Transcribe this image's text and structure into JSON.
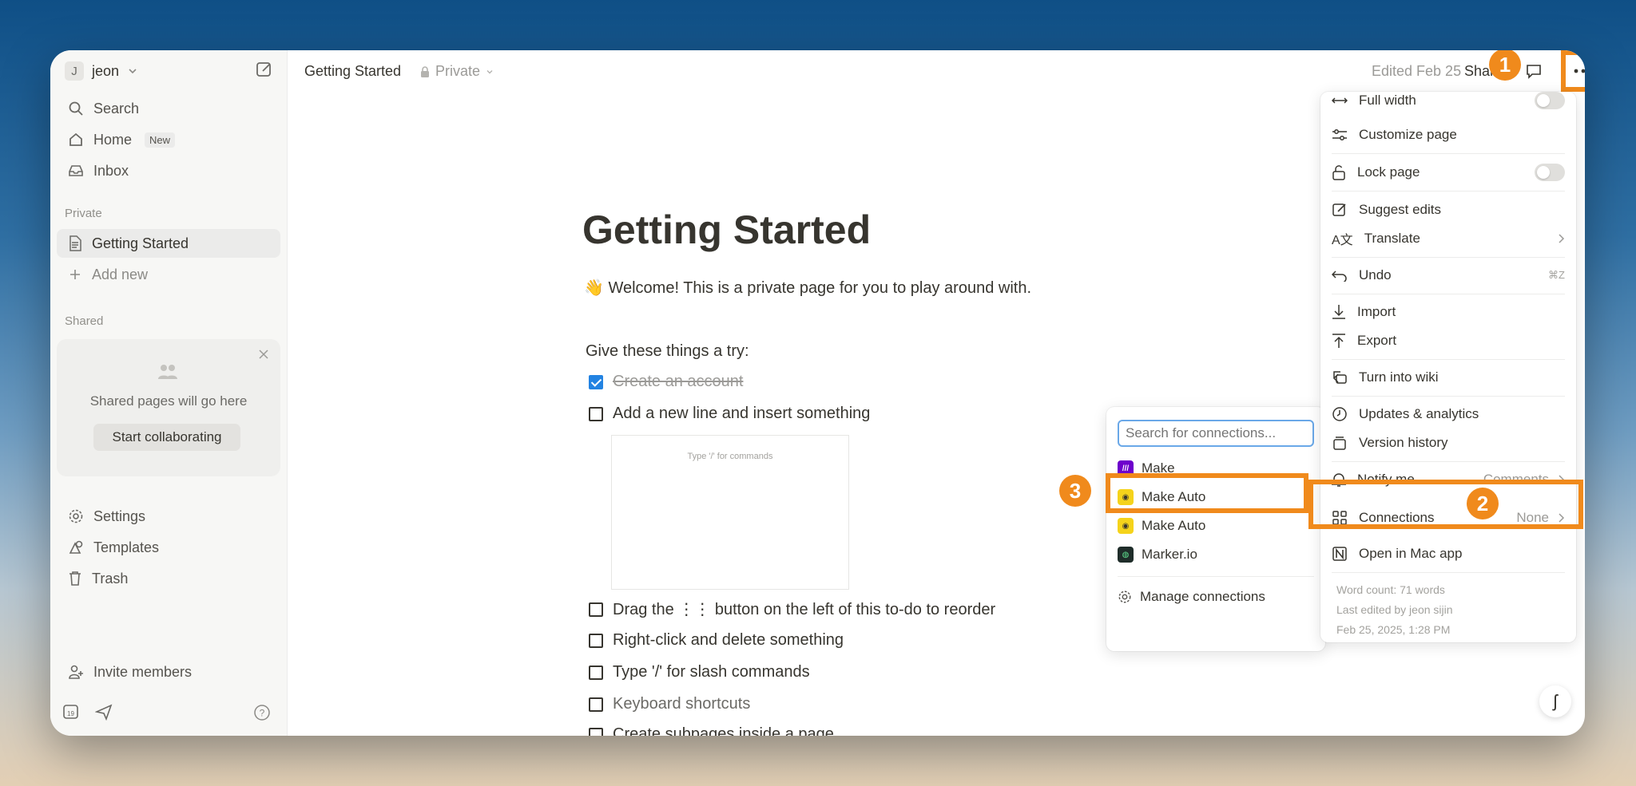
{
  "sidebar": {
    "workspace_initial": "J",
    "workspace_name": "jeon",
    "nav": [
      {
        "label": "Search"
      },
      {
        "label": "Home",
        "badge": "New"
      },
      {
        "label": "Inbox"
      }
    ],
    "private_label": "Private",
    "private_pages": [
      {
        "label": "Getting Started"
      }
    ],
    "add_new": "Add new",
    "shared_label": "Shared",
    "shared_card": {
      "text": "Shared pages will go here",
      "button": "Start collaborating"
    },
    "bottom_nav": [
      {
        "label": "Settings"
      },
      {
        "label": "Templates"
      },
      {
        "label": "Trash"
      }
    ],
    "invite": "Invite members",
    "calendar_day": "19"
  },
  "topbar": {
    "breadcrumb": "Getting Started",
    "privacy": "Private",
    "edited": "Edited Feb 25",
    "share": "Share"
  },
  "page": {
    "title": "Getting Started",
    "welcome_emoji": "👋",
    "welcome": "Welcome! This is a private page for you to play around with.",
    "give": "Give these things a try:",
    "embed_placeholder": "Type '/' for commands",
    "todos": [
      {
        "text": "Create an account",
        "checked": true
      },
      {
        "text": "Add a new line and insert something",
        "checked": false
      },
      {
        "text": "Drag the ⋮⋮ button on the left of this to-do to reorder",
        "checked": false
      },
      {
        "text": "Right-click and delete something",
        "checked": false
      },
      {
        "text": "Type '/' for slash commands",
        "checked": false
      },
      {
        "text": "Keyboard shortcuts",
        "checked": false
      },
      {
        "text": "Create subpages inside a page",
        "checked": false
      }
    ]
  },
  "menu": {
    "full_width": "Full width",
    "customize": "Customize page",
    "lock": "Lock page",
    "suggest": "Suggest edits",
    "translate": "Translate",
    "undo": "Undo",
    "undo_kbd": "⌘Z",
    "import": "Import",
    "export": "Export",
    "wiki": "Turn into wiki",
    "updates": "Updates & analytics",
    "version": "Version history",
    "notify": "Notify me",
    "notify_value": "Comments",
    "connections": "Connections",
    "connections_value": "None",
    "open_mac": "Open in Mac app",
    "word_count": "Word count: 71 words",
    "last_edited": "Last edited by jeon sijin",
    "timestamp": "Feb 25, 2025, 1:28 PM"
  },
  "connections_submenu": {
    "search_placeholder": "Search for connections...",
    "items": [
      {
        "label": "Make",
        "logo": "make-logo"
      },
      {
        "label": "Make Auto",
        "logo": "make-auto-logo"
      },
      {
        "label": "Make Auto",
        "logo": "make-auto-logo"
      },
      {
        "label": "Marker.io",
        "logo": "marker-io-logo"
      }
    ],
    "manage": "Manage connections"
  },
  "step_markers": [
    "1",
    "2",
    "3"
  ],
  "colors": {
    "accent": "#f08a1c",
    "checkbox": "#2383e2"
  }
}
